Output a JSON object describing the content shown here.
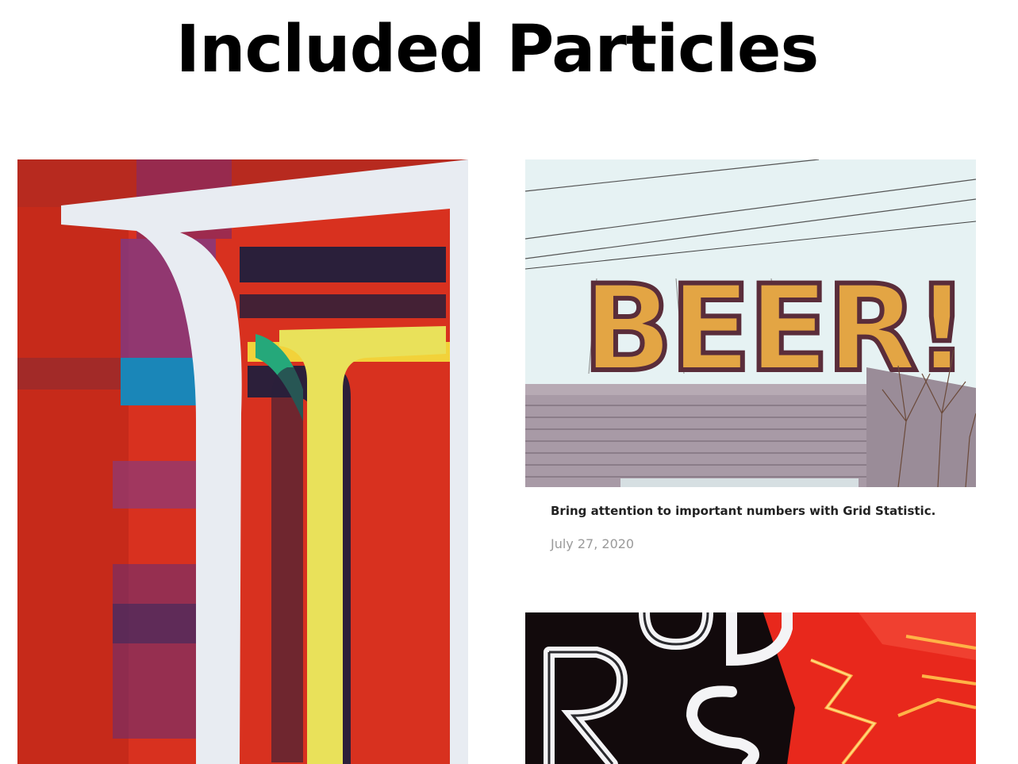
{
  "page": {
    "title": "Included Particles"
  },
  "cards": {
    "feature": {
      "image_alt": "Abstract painted letterform mural in red, purple, yellow and white"
    },
    "beer": {
      "image_alt": "BEER! marquee sign on a building rooftop",
      "title": "Bring attention to important numbers with Grid Statistic.",
      "date": "July 27, 2020"
    },
    "neon": {
      "image_alt": "White and red neon letter signs"
    }
  }
}
